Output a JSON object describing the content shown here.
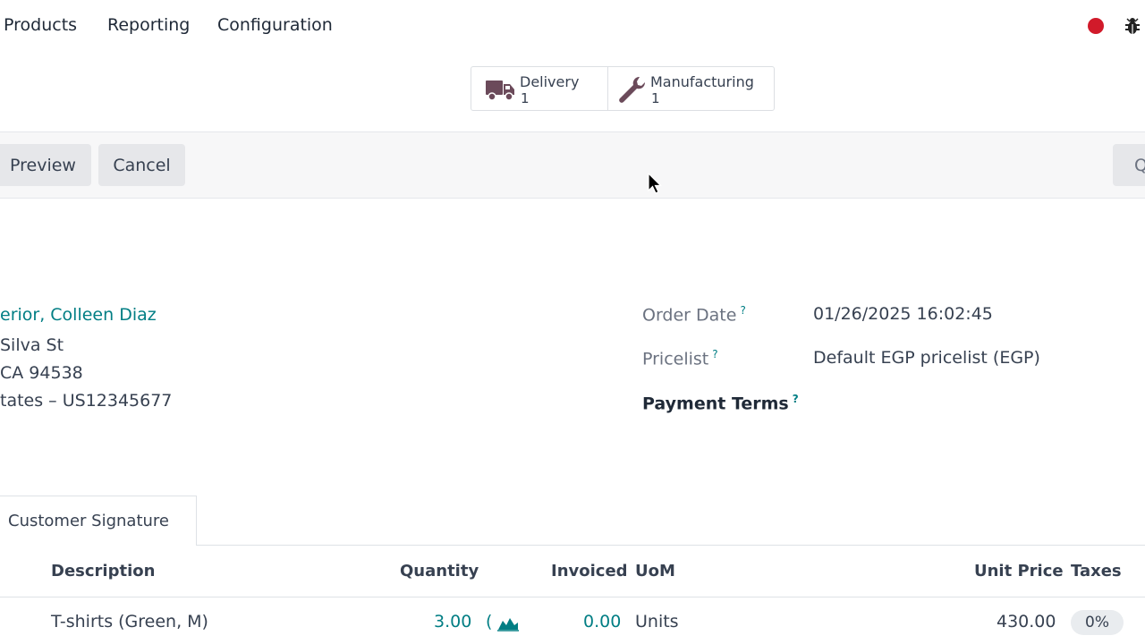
{
  "navbar": {
    "items": [
      "Products",
      "Reporting",
      "Configuration"
    ]
  },
  "smart_buttons": {
    "delivery": {
      "label": "Delivery",
      "count": "1"
    },
    "manufacturing": {
      "label": "Manufacturing",
      "count": "1"
    }
  },
  "controls": {
    "preview": "Preview",
    "cancel": "Cancel",
    "right_button": "Q"
  },
  "customer": {
    "name": "erior, Colleen Diaz",
    "street": "Silva St",
    "city": "CA 94538",
    "country_vat": "tates – US12345677"
  },
  "order_fields": {
    "order_date_label": "Order Date",
    "order_date_value": "01/26/2025 16:02:45",
    "pricelist_label": "Pricelist",
    "pricelist_value": "Default EGP pricelist (EGP)",
    "payment_terms_label": "Payment Terms",
    "help_mark": "?"
  },
  "tab": {
    "label": "Customer Signature"
  },
  "table": {
    "columns": {
      "description": "Description",
      "quantity": "Quantity",
      "invoiced": "Invoiced",
      "uom": "UoM",
      "unit_price": "Unit Price",
      "taxes": "Taxes"
    },
    "rows": [
      {
        "description": "T-shirts (Green, M)",
        "quantity": "3.00",
        "quantity_suffix": "(",
        "invoiced": "0.00",
        "uom": "Units",
        "unit_price": "430.00",
        "taxes": "0%"
      }
    ]
  },
  "colors": {
    "accent": "#017e84",
    "record_indicator": "#d11a2a",
    "icon": "#6b4a5a"
  },
  "icons": [
    "record-dot-icon",
    "bug-icon",
    "truck-icon",
    "wrench-icon",
    "forecast-chart-icon",
    "mouse-cursor-icon"
  ]
}
